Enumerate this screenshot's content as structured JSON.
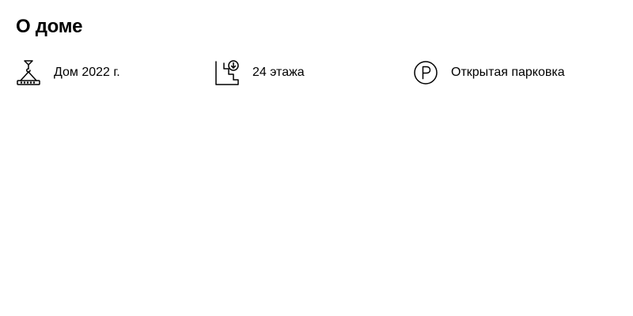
{
  "section": {
    "title": "О доме"
  },
  "features": [
    {
      "icon": "crane-hook-icon",
      "label": "Дом 2022 г."
    },
    {
      "icon": "stairs-floors-icon",
      "label": "24 этажа"
    },
    {
      "icon": "parking-icon",
      "label": "Открытая парковка"
    }
  ],
  "colors": {
    "text": "#000000",
    "background": "#ffffff"
  }
}
